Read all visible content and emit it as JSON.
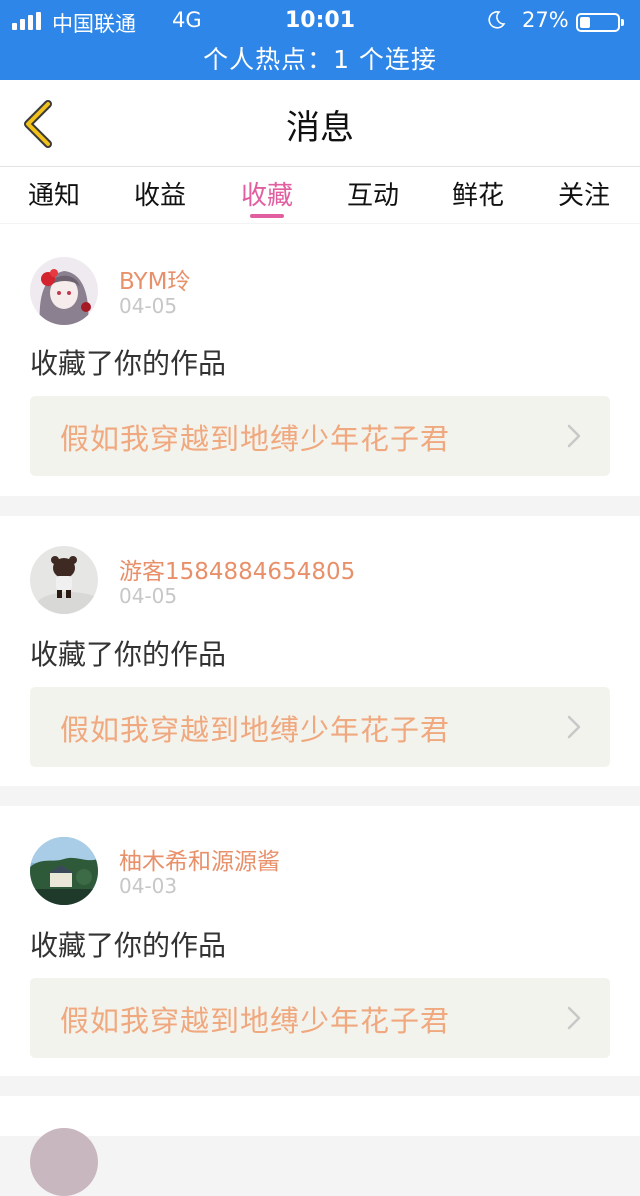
{
  "status_bar": {
    "carrier": "中国联通",
    "network": "4G",
    "time": "10:01",
    "battery_percent": "27%",
    "battery_level": 0.27,
    "hotspot_text": "个人热点：1 个连接",
    "background_color": "#2e86e8"
  },
  "nav": {
    "title": "消息",
    "back_icon": "chevron-left-icon"
  },
  "tabs": [
    {
      "label": "通知",
      "active": false
    },
    {
      "label": "收益",
      "active": false
    },
    {
      "label": "收藏",
      "active": true
    },
    {
      "label": "互动",
      "active": false
    },
    {
      "label": "鲜花",
      "active": false
    },
    {
      "label": "关注",
      "active": false
    }
  ],
  "accent_color": "#e15fa0",
  "messages": [
    {
      "username": "BYM玲",
      "date": "04-05",
      "action": "收藏了你的作品",
      "work_title": "假如我穿越到地缚少年花子君"
    },
    {
      "username": "游客1584884654805",
      "date": "04-05",
      "action": "收藏了你的作品",
      "work_title": "假如我穿越到地缚少年花子君"
    },
    {
      "username": "柚木希和源源酱",
      "date": "04-03",
      "action": "收藏了你的作品",
      "work_title": "假如我穿越到地缚少年花子君"
    }
  ]
}
